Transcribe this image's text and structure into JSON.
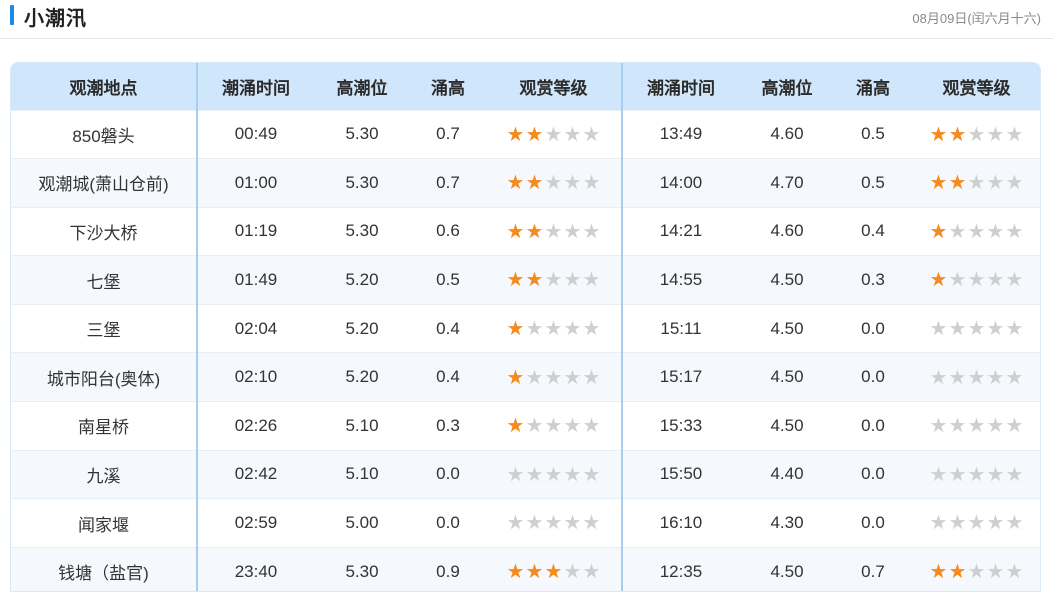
{
  "header": {
    "title": "小潮汛",
    "date": "08月09日(闰六月十六)"
  },
  "columns": [
    "观潮地点",
    "潮涌时间",
    "高潮位",
    "涌高",
    "观赏等级",
    "潮涌时间",
    "高潮位",
    "涌高",
    "观赏等级"
  ],
  "rows": [
    {
      "place": "850磐头",
      "t1": "00:49",
      "h1": "5.30",
      "s1": "0.7",
      "r1": 2,
      "t2": "13:49",
      "h2": "4.60",
      "s2": "0.5",
      "r2": 2
    },
    {
      "place": "观潮城(萧山仓前)",
      "t1": "01:00",
      "h1": "5.30",
      "s1": "0.7",
      "r1": 2,
      "t2": "14:00",
      "h2": "4.70",
      "s2": "0.5",
      "r2": 2
    },
    {
      "place": "下沙大桥",
      "t1": "01:19",
      "h1": "5.30",
      "s1": "0.6",
      "r1": 2,
      "t2": "14:21",
      "h2": "4.60",
      "s2": "0.4",
      "r2": 1
    },
    {
      "place": "七堡",
      "t1": "01:49",
      "h1": "5.20",
      "s1": "0.5",
      "r1": 2,
      "t2": "14:55",
      "h2": "4.50",
      "s2": "0.3",
      "r2": 1
    },
    {
      "place": "三堡",
      "t1": "02:04",
      "h1": "5.20",
      "s1": "0.4",
      "r1": 1,
      "t2": "15:11",
      "h2": "4.50",
      "s2": "0.0",
      "r2": 0
    },
    {
      "place": "城市阳台(奥体)",
      "t1": "02:10",
      "h1": "5.20",
      "s1": "0.4",
      "r1": 1,
      "t2": "15:17",
      "h2": "4.50",
      "s2": "0.0",
      "r2": 0
    },
    {
      "place": "南星桥",
      "t1": "02:26",
      "h1": "5.10",
      "s1": "0.3",
      "r1": 1,
      "t2": "15:33",
      "h2": "4.50",
      "s2": "0.0",
      "r2": 0
    },
    {
      "place": "九溪",
      "t1": "02:42",
      "h1": "5.10",
      "s1": "0.0",
      "r1": 0,
      "t2": "15:50",
      "h2": "4.40",
      "s2": "0.0",
      "r2": 0
    },
    {
      "place": "闻家堰",
      "t1": "02:59",
      "h1": "5.00",
      "s1": "0.0",
      "r1": 0,
      "t2": "16:10",
      "h2": "4.30",
      "s2": "0.0",
      "r2": 0
    },
    {
      "place": "钱塘（盐官)",
      "t1": "23:40",
      "h1": "5.30",
      "s1": "0.9",
      "r1": 3,
      "t2": "12:35",
      "h2": "4.50",
      "s2": "0.7",
      "r2": 2
    }
  ],
  "rating_max": 5,
  "colors": {
    "accent": "#1e88e5",
    "header_bg": "#cfe6fb",
    "star_on": "#f58a1f",
    "star_off": "#cfcfcf"
  },
  "icons": {
    "rating": "star-icon"
  }
}
